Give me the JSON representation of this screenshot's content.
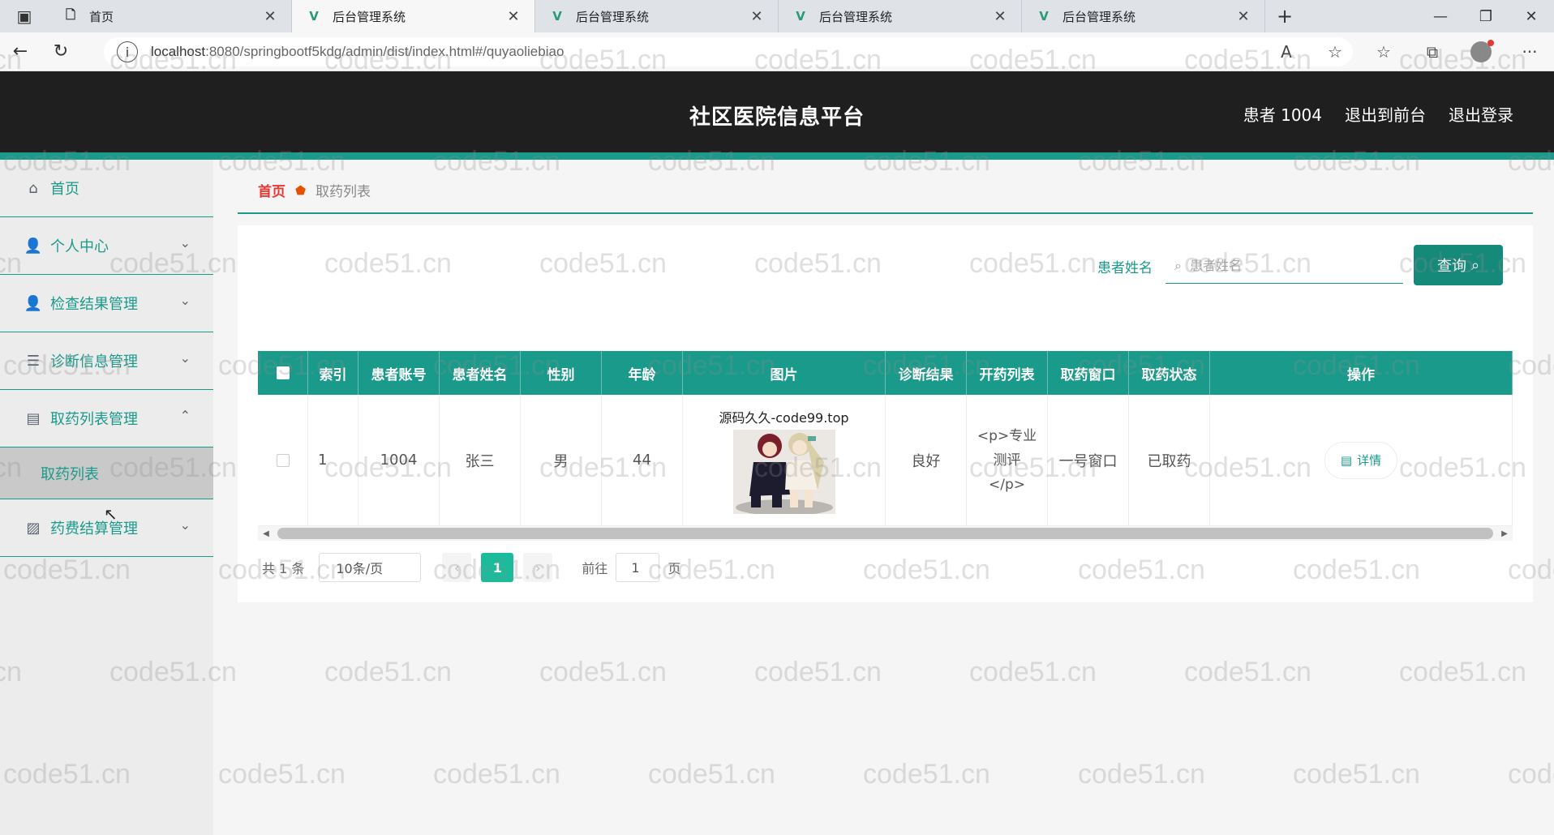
{
  "browser": {
    "tabs": [
      {
        "title": "首页",
        "icon": "page-icon",
        "active": false
      },
      {
        "title": "后台管理系统",
        "icon": "vue-icon",
        "active": true
      },
      {
        "title": "后台管理系统",
        "icon": "vue-icon",
        "active": false
      },
      {
        "title": "后台管理系统",
        "icon": "vue-icon",
        "active": false
      },
      {
        "title": "后台管理系统",
        "icon": "vue-icon",
        "active": false
      }
    ],
    "url_host": "localhost",
    "url_rest": ":8080/springbootf5kdg/admin/dist/index.html#/quyaoliebiao"
  },
  "header": {
    "title": "社区医院信息平台",
    "user": "患者 1004",
    "to_front": "退出到前台",
    "logout": "退出登录"
  },
  "sidebar": {
    "items": [
      {
        "label": "首页",
        "icon": "home-icon",
        "arrow": ""
      },
      {
        "label": "个人中心",
        "icon": "user-icon",
        "arrow": "⌄"
      },
      {
        "label": "检查结果管理",
        "icon": "user-icon",
        "arrow": "⌄"
      },
      {
        "label": "诊断信息管理",
        "icon": "list-icon",
        "arrow": "⌄"
      },
      {
        "label": "取药列表管理",
        "icon": "briefcase-icon",
        "arrow": "⌃"
      },
      {
        "label": "药费结算管理",
        "icon": "chart-icon",
        "arrow": "⌄"
      }
    ],
    "sub_item": "取药列表"
  },
  "breadcrumb": {
    "home": "首页",
    "current": "取药列表"
  },
  "search": {
    "label": "患者姓名",
    "placeholder": "患者姓名",
    "button": "查询"
  },
  "table": {
    "headers": [
      "索引",
      "患者账号",
      "患者姓名",
      "性别",
      "年龄",
      "图片",
      "诊断结果",
      "开药列表",
      "取药窗口",
      "取药状态",
      "操作"
    ],
    "rows": [
      {
        "index": "1",
        "account": "1004",
        "name": "张三",
        "gender": "男",
        "age": "44",
        "image_caption": "源码久久-code99.top",
        "diagnosis": "良好",
        "prescription": "<p>专业测评</p>",
        "window": "一号窗口",
        "status": "已取药",
        "action": "详情"
      }
    ]
  },
  "pagination": {
    "total": "共 1 条",
    "page_size": "10条/页",
    "prev": "‹",
    "current": "1",
    "next": "›",
    "goto_label": "前往",
    "goto_value": "1",
    "page_suffix": "页"
  },
  "watermark": "code51.cn",
  "colors": {
    "accent": "#1a9a8a",
    "header_bg": "#1f1f1f",
    "sidebar_bg": "#ececec",
    "active_page": "#1abc9c"
  }
}
